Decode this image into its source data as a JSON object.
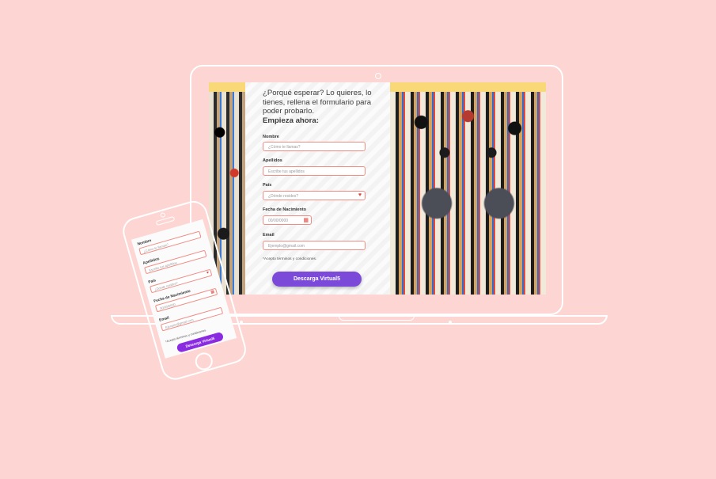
{
  "desktop": {
    "intro_text": "¿Porqué esperar? Lo quieres, lo tienes, rellena el formulario para poder probarlo.",
    "intro_strong": "Empieza ahora:",
    "fields": [
      {
        "label": "Nombre",
        "placeholder": "¿Cómo te llamas?"
      },
      {
        "label": "Apellidos",
        "placeholder": "Escribe tus apellidos"
      },
      {
        "label": "País",
        "placeholder": "¿Dónde resides?"
      },
      {
        "label": "Fecha de Nacimiento",
        "placeholder": "00/00/0000"
      },
      {
        "label": "Email",
        "placeholder": "Ejemplo@gmail.com"
      }
    ],
    "terms": "*Acepto términos y condiciones.",
    "cta_label": "Descarga Virtual5"
  },
  "mobile": {
    "fields": [
      {
        "label": "Nombre",
        "placeholder": "¿Cómo te llamas?"
      },
      {
        "label": "Apellidos",
        "placeholder": "Escribe tus apellidos"
      },
      {
        "label": "País",
        "placeholder": "¿Dónde resides?"
      },
      {
        "label": "Fecha de Nacimiento",
        "placeholder": "00/00/0000"
      },
      {
        "label": "Email",
        "placeholder": "Ejemplo@gmail.com"
      }
    ],
    "terms": "*Acepto términos y condiciones.",
    "cta_label": "Descarga Virtual5"
  },
  "icons": {
    "select_icon": "heart-icon",
    "date_icon": "calendar-icon"
  },
  "colors": {
    "background": "#fdd6d3",
    "accent_yellow": "#f8d877",
    "field_border": "#f08c84",
    "cta_desktop": "#7c4ad8",
    "cta_mobile": "#8a2be2",
    "icon_red": "#e2443c"
  }
}
